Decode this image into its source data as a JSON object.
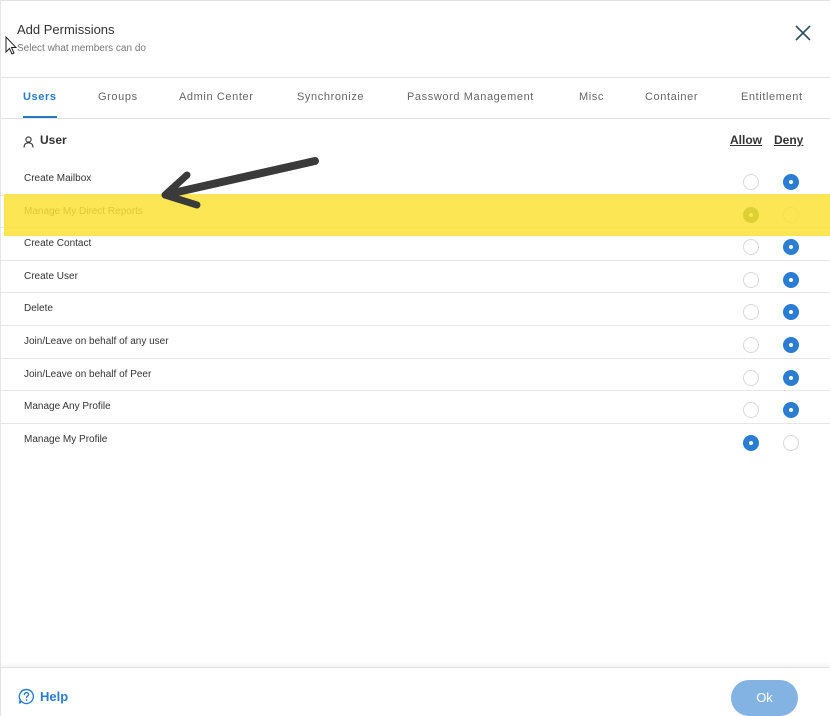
{
  "dialog": {
    "title": "Add Permissions",
    "subtitle": "Select what members can do"
  },
  "tabs": [
    {
      "label": "Users",
      "active": true
    },
    {
      "label": "Groups",
      "active": false
    },
    {
      "label": "Admin Center",
      "active": false
    },
    {
      "label": "Synchronize",
      "active": false
    },
    {
      "label": "Password Management",
      "active": false
    },
    {
      "label": "Misc",
      "active": false
    },
    {
      "label": "Container",
      "active": false
    },
    {
      "label": "Entitlement",
      "active": false
    }
  ],
  "section": {
    "title": "User",
    "allow_label": "Allow",
    "deny_label": "Deny"
  },
  "permissions": [
    {
      "label": "Create Mailbox",
      "value": "deny"
    },
    {
      "label": "Manage My Direct Reports",
      "value": "allow",
      "highlighted": true
    },
    {
      "label": "Create Contact",
      "value": "deny"
    },
    {
      "label": "Create User",
      "value": "deny"
    },
    {
      "label": "Delete",
      "value": "deny"
    },
    {
      "label": "Join/Leave on behalf of any user",
      "value": "deny"
    },
    {
      "label": "Join/Leave on behalf of Peer",
      "value": "deny"
    },
    {
      "label": "Manage Any Profile",
      "value": "deny"
    },
    {
      "label": "Manage My Profile",
      "value": "allow"
    }
  ],
  "footer": {
    "help_label": "Help",
    "ok_label": "Ok"
  },
  "colors": {
    "accent": "#2b7cd3",
    "ok_button": "#82b3e3",
    "highlight": "#fbe236",
    "selected_highlighted": "#2e6b2e"
  },
  "icons": {
    "close": "close-icon",
    "user": "user-icon",
    "help": "help-icon",
    "arrow": "arrow-annotation"
  }
}
